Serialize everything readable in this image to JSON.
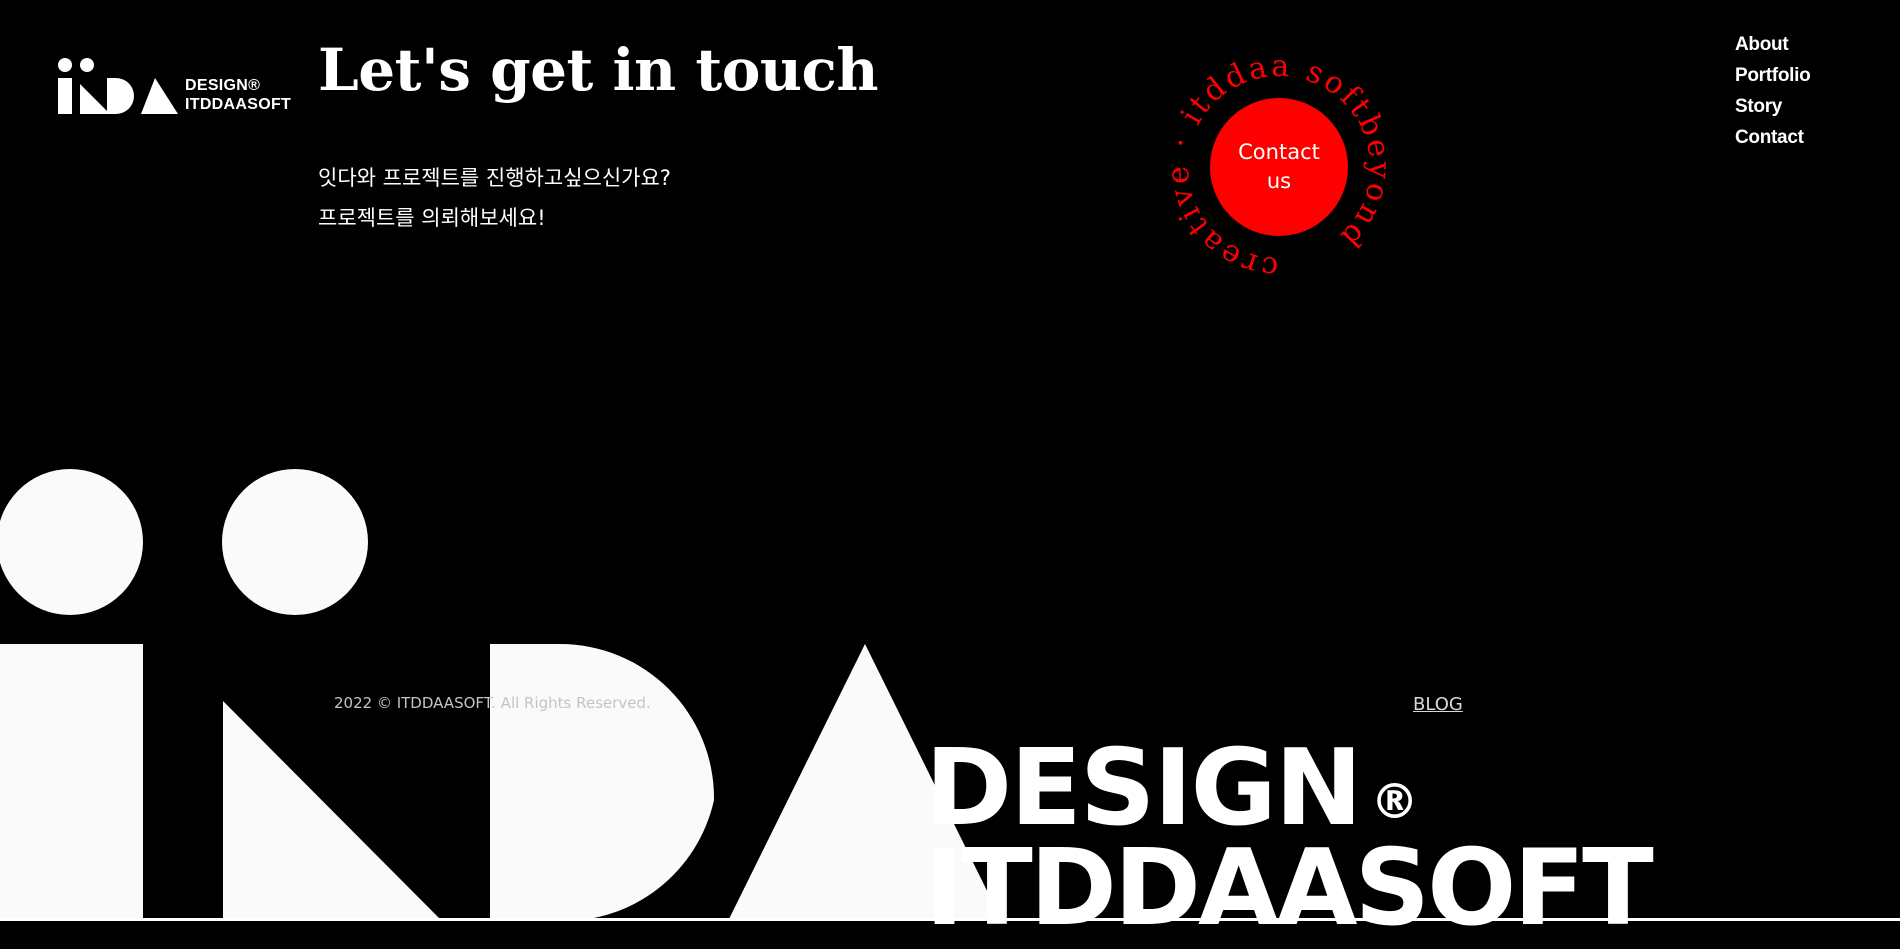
{
  "header": {
    "logo": {
      "wordmark_top": "DESIGN®",
      "wordmark_bottom": "ITDDAASOFT"
    },
    "nav": [
      {
        "label": "About"
      },
      {
        "label": "Portfolio"
      },
      {
        "label": "Story"
      },
      {
        "label": "Contact"
      }
    ]
  },
  "main": {
    "title": "Let's get in touch",
    "intro_lines": [
      "잇다와 프로젝트를 진행하고싶으신가요?",
      "프로젝트를 의뢰해보세요!"
    ],
    "contact_badge": {
      "button_label": "Contact us",
      "ring_text": "creative · itddaa softbeyond"
    }
  },
  "footer": {
    "copyright": "2022 © ITDDAASOFT. All Rights Reserved.",
    "blog_link": "BLOG",
    "big_wordmark_top": "DESIGN",
    "big_wordmark_mark": "®",
    "big_wordmark_bottom": "ITDDAASOFT"
  },
  "colors": {
    "background": "#000000",
    "text": "#ffffff",
    "accent": "#ff0000"
  }
}
